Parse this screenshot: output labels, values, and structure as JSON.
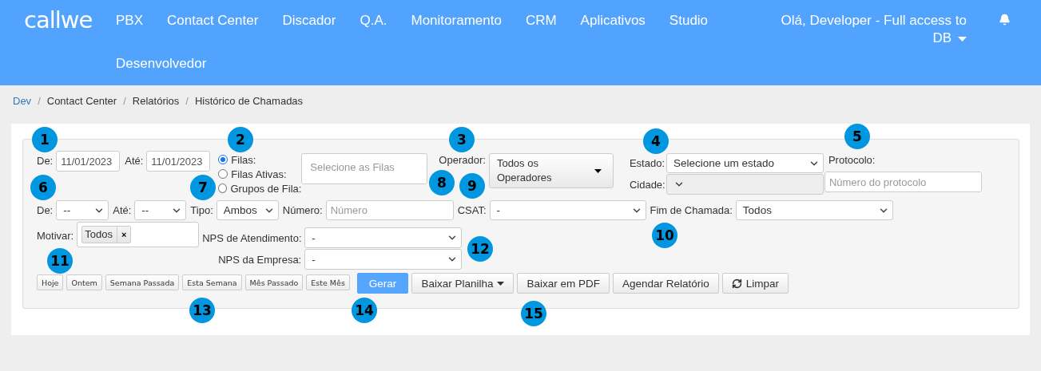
{
  "navbar": {
    "brand": "callwe",
    "items": [
      "PBX",
      "Contact Center",
      "Discador",
      "Q.A.",
      "Monitoramento",
      "CRM",
      "Aplicativos",
      "Studio",
      "Desenvolvedor"
    ],
    "user": "Olá, Developer - Full access to DB"
  },
  "breadcrumb": {
    "separator": "/",
    "items": [
      {
        "label": "Dev",
        "link": true
      },
      {
        "label": "Contact Center",
        "link": false
      },
      {
        "label": "Relatórios",
        "link": false
      },
      {
        "label": "Histórico de Chamadas",
        "link": false
      }
    ]
  },
  "filters": {
    "date_from": {
      "label": "De:",
      "value": "11/01/2023"
    },
    "date_to": {
      "label": "Até:",
      "value": "11/01/2023"
    },
    "queue_mode": [
      {
        "label": "Filas:",
        "selected": true
      },
      {
        "label": "Filas Ativas:",
        "selected": false
      },
      {
        "label": "Grupos de Fila:",
        "selected": false
      }
    ],
    "queue_select": {
      "placeholder": "Selecione as Filas"
    },
    "operator": {
      "label": "Operador:",
      "value": "Todos os Operadores"
    },
    "estado": {
      "label": "Estado:",
      "value": "Selecione um estado",
      "disabled": false
    },
    "cidade": {
      "label": "Cidade:",
      "disabled": true
    },
    "protocolo": {
      "label": "Protocolo:",
      "placeholder": "Número do protocolo"
    },
    "row2": [
      {
        "kind": "select",
        "label": "De:",
        "value": "--"
      },
      {
        "kind": "select",
        "label": "Até:",
        "value": "--"
      },
      {
        "kind": "select",
        "label": "Tipo:",
        "value": "Ambos"
      },
      {
        "kind": "input",
        "label": "Número:",
        "placeholder": "Número"
      },
      {
        "kind": "select",
        "label": "CSAT:",
        "value": "-"
      },
      {
        "kind": "select",
        "label": "Fim de Chamada:",
        "value": "Todos"
      }
    ],
    "motivar": {
      "label": "Motivar:",
      "tags": [
        "Todos"
      ],
      "remove": "×"
    },
    "nps": [
      {
        "label": "NPS de Atendimento:",
        "value": "-"
      },
      {
        "label": "NPS da Empresa:",
        "value": "-"
      }
    ],
    "quick_ranges": [
      "Hoje",
      "Ontem",
      "Semana Passada",
      "Esta Semana",
      "Mês Passado",
      "Este Mês"
    ],
    "actions": [
      {
        "label": "Gerar",
        "kind": "primary"
      },
      {
        "label": "Baixar Planilha",
        "kind": "dropdown"
      },
      {
        "label": "Baixar em PDF",
        "kind": "plain"
      },
      {
        "label": "Agendar Relatório",
        "kind": "plain"
      },
      {
        "label": "Limpar",
        "kind": "refresh"
      }
    ]
  },
  "markers": [
    "1",
    "2",
    "3",
    "4",
    "5",
    "6",
    "7",
    "8",
    "9",
    "10",
    "11",
    "12",
    "13",
    "14",
    "15"
  ]
}
